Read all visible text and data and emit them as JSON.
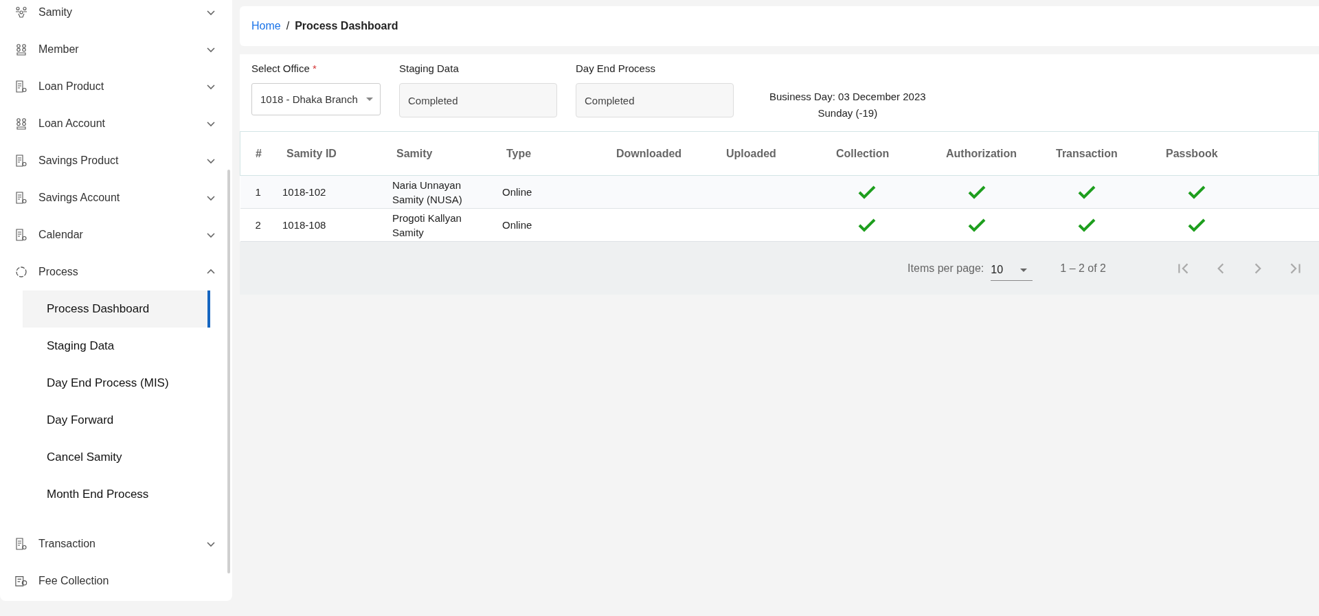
{
  "sidebar": {
    "items": [
      {
        "label": "Samity",
        "kind": "group",
        "expanded": false
      },
      {
        "label": "Member",
        "kind": "group",
        "expanded": false
      },
      {
        "label": "Loan Product",
        "kind": "group",
        "expanded": false
      },
      {
        "label": "Loan Account",
        "kind": "group",
        "expanded": false
      },
      {
        "label": "Savings Product",
        "kind": "group",
        "expanded": false
      },
      {
        "label": "Savings Account",
        "kind": "group",
        "expanded": false
      },
      {
        "label": "Calendar",
        "kind": "group",
        "expanded": false
      },
      {
        "label": "Process",
        "kind": "group",
        "expanded": true,
        "children": [
          {
            "label": "Process Dashboard",
            "selected": true
          },
          {
            "label": "Staging Data",
            "selected": false
          },
          {
            "label": "Day End Process (MIS)",
            "selected": false
          },
          {
            "label": "Day Forward",
            "selected": false
          },
          {
            "label": "Cancel Samity",
            "selected": false
          },
          {
            "label": "Month End Process",
            "selected": false
          }
        ]
      },
      {
        "label": "Transaction",
        "kind": "group",
        "expanded": false
      },
      {
        "label": "Fee Collection",
        "kind": "link"
      }
    ]
  },
  "breadcrumb": {
    "separator": "/",
    "items": [
      {
        "label": "Home",
        "kind": "link"
      },
      {
        "label": "Process Dashboard",
        "kind": "current"
      }
    ]
  },
  "form": {
    "office": {
      "label": "Select Office",
      "required_mark": "*",
      "value": "1018 - Dhaka Branch"
    },
    "staging": {
      "label": "Staging Data",
      "value": "Completed"
    },
    "day_end": {
      "label": "Day End Process",
      "value": "Completed"
    },
    "business_day": "Business Day: 03 December 2023",
    "weekday": "Sunday (-19)"
  },
  "table": {
    "columns": [
      {
        "label": "#",
        "kind": "text"
      },
      {
        "label": "Samity ID",
        "kind": "text"
      },
      {
        "label": "Samity",
        "kind": "text"
      },
      {
        "label": "Type",
        "kind": "text"
      },
      {
        "label": "Downloaded",
        "kind": "check"
      },
      {
        "label": "Uploaded",
        "kind": "check"
      },
      {
        "label": "Collection",
        "kind": "check"
      },
      {
        "label": "Authorization",
        "kind": "check"
      },
      {
        "label": "Transaction",
        "kind": "check"
      },
      {
        "label": "Passbook",
        "kind": "check"
      }
    ],
    "rows": [
      {
        "cells": [
          "1",
          "1018-102",
          "Naria Unnayan Samity (NUSA)",
          "Online",
          false,
          false,
          true,
          true,
          true,
          true
        ]
      },
      {
        "cells": [
          "2",
          "1018-108",
          "Progoti Kallyan Samity",
          "Online",
          false,
          false,
          true,
          true,
          true,
          true
        ]
      }
    ]
  },
  "paginator": {
    "label": "Items per page:",
    "page_size": "10",
    "range": "1 – 2 of 2"
  }
}
